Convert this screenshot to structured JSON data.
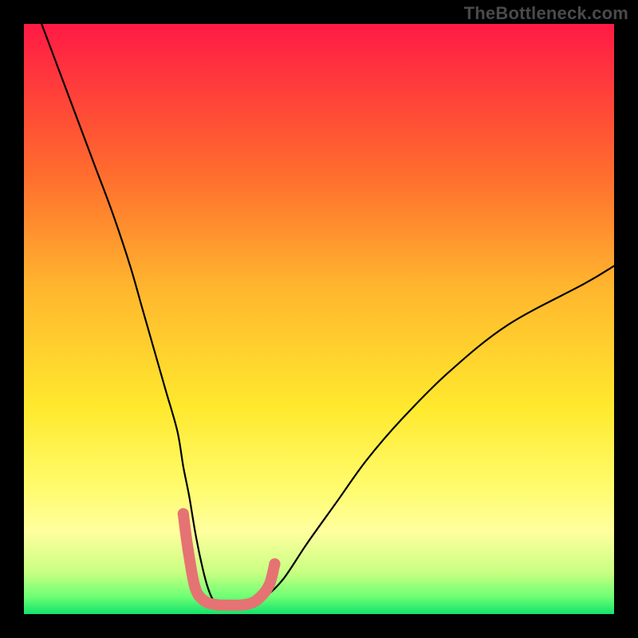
{
  "watermark": "TheBottleneck.com",
  "chart_data": {
    "type": "line",
    "title": "",
    "xlabel": "",
    "ylabel": "",
    "xlim": [
      0,
      100
    ],
    "ylim": [
      0,
      100
    ],
    "grid": false,
    "legend": false,
    "gradient_stops": [
      {
        "offset": 0,
        "color": "#ff1a45"
      },
      {
        "offset": 25,
        "color": "#ff6b2e"
      },
      {
        "offset": 45,
        "color": "#ffb72e"
      },
      {
        "offset": 65,
        "color": "#ffe92e"
      },
      {
        "offset": 78,
        "color": "#fffb6a"
      },
      {
        "offset": 86,
        "color": "#ffff9e"
      },
      {
        "offset": 93,
        "color": "#c8ff82"
      },
      {
        "offset": 97,
        "color": "#6fff74"
      },
      {
        "offset": 100,
        "color": "#13e36b"
      }
    ],
    "series": [
      {
        "name": "bottleneck-curve",
        "color": "#000000",
        "x": [
          3,
          6,
          9,
          12,
          15,
          18,
          20,
          22,
          24,
          26,
          27,
          28,
          29,
          30,
          31,
          32,
          33,
          35,
          37,
          39,
          41,
          44,
          48,
          53,
          58,
          64,
          72,
          82,
          95,
          100
        ],
        "y": [
          100,
          92,
          84,
          76,
          68,
          59,
          52,
          45,
          38,
          31,
          25,
          20,
          14,
          9,
          5,
          2.5,
          1.8,
          1.5,
          1.5,
          1.8,
          3,
          6,
          12,
          19,
          26,
          33,
          41,
          49,
          56,
          59
        ]
      }
    ],
    "markers": {
      "name": "highlight-dots",
      "color": "#e57373",
      "radius_px": 7,
      "points": [
        {
          "x": 27.0,
          "y": 17.0
        },
        {
          "x": 27.8,
          "y": 11.0
        },
        {
          "x": 29.0,
          "y": 4.5
        },
        {
          "x": 30.5,
          "y": 2.3
        },
        {
          "x": 32.5,
          "y": 1.6
        },
        {
          "x": 35.0,
          "y": 1.5
        },
        {
          "x": 37.5,
          "y": 1.6
        },
        {
          "x": 39.5,
          "y": 2.4
        },
        {
          "x": 41.5,
          "y": 4.8
        },
        {
          "x": 42.5,
          "y": 8.5
        }
      ]
    }
  }
}
